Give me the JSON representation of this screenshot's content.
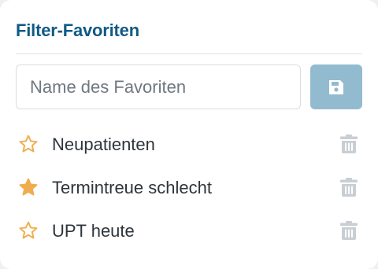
{
  "panel": {
    "title": "Filter-Favoriten"
  },
  "name_input": {
    "value": "",
    "placeholder": "Name des Favoriten"
  },
  "save_button": {
    "icon": "floppy-disk-icon"
  },
  "favorites": [
    {
      "label": "Neupatienten",
      "starred": false
    },
    {
      "label": "Termintreue schlecht",
      "starred": true
    },
    {
      "label": "UPT heute",
      "starred": false
    }
  ],
  "colors": {
    "title": "#105a84",
    "star": "#f0ad4e",
    "save_button": "#92bbcf",
    "trash_icon": "#c9ced4"
  }
}
